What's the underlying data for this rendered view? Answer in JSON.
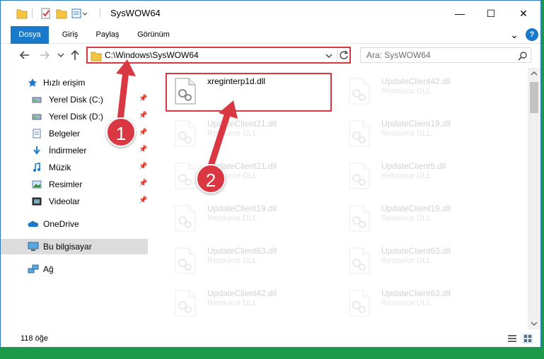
{
  "window": {
    "title": "SysWOW64",
    "minimize_glyph": "—",
    "maximize_glyph": "☐",
    "close_glyph": "✕"
  },
  "ribbon": {
    "tabs": [
      "Dosya",
      "Giriş",
      "Paylaş",
      "Görünüm"
    ],
    "collapse_glyph": "⌄",
    "help_glyph": "?"
  },
  "address": {
    "path": "C:\\Windows\\SysWOW64",
    "search_placeholder": "Ara: SysWOW64"
  },
  "sidebar": {
    "items": [
      {
        "label": "Hızlı erişim",
        "icon": "star-icon",
        "pinned": false
      },
      {
        "label": "Yerel Disk (C:)",
        "icon": "drive-icon",
        "pinned": true
      },
      {
        "label": "Yerel Disk (D:)",
        "icon": "drive-icon",
        "pinned": true
      },
      {
        "label": "Belgeler",
        "icon": "documents-icon",
        "pinned": true
      },
      {
        "label": "İndirmeler",
        "icon": "download-icon",
        "pinned": true
      },
      {
        "label": "Müzik",
        "icon": "music-icon",
        "pinned": true
      },
      {
        "label": "Resimler",
        "icon": "pictures-icon",
        "pinned": true
      },
      {
        "label": "Videolar",
        "icon": "videos-icon",
        "pinned": true
      },
      {
        "label": "OneDrive",
        "icon": "cloud-icon",
        "pinned": false
      },
      {
        "label": "Bu bilgisayar",
        "icon": "computer-icon",
        "pinned": false
      },
      {
        "label": "Ağ",
        "icon": "network-icon",
        "pinned": false
      }
    ]
  },
  "files": [
    {
      "name": "xreginterp1d.dll",
      "desc": "",
      "faded": false
    },
    {
      "name": "UpdateClient42.dll",
      "desc": "Resource DLL",
      "faded": true
    },
    {
      "name": "UpdateClient21.dll",
      "desc": "Resource DLL",
      "faded": true
    },
    {
      "name": "UpdateClient19.dll",
      "desc": "Resource DLL",
      "faded": true
    },
    {
      "name": "UpdateClient21.dll",
      "desc": "Resource DLL",
      "faded": true
    },
    {
      "name": "UpdateClient5.dll",
      "desc": "Resource DLL",
      "faded": true
    },
    {
      "name": "UpdateClient19.dll",
      "desc": "Resource DLL",
      "faded": true
    },
    {
      "name": "UpdateClient19.dll",
      "desc": "Resource DLL",
      "faded": true
    },
    {
      "name": "UpdateClient63.dll",
      "desc": "Resource DLL",
      "faded": true
    },
    {
      "name": "UpdateClient63.dll",
      "desc": "Resource DLL",
      "faded": true
    },
    {
      "name": "UpdateClient42.dll",
      "desc": "Resource DLL",
      "faded": true
    },
    {
      "name": "UpdateClient63.dll",
      "desc": "Resource DLL",
      "faded": true
    }
  ],
  "status": {
    "count": "118 öğe"
  },
  "annotations": {
    "step1": "1",
    "step2": "2",
    "color": "#d93842"
  },
  "colors": {
    "accent": "#1979ca",
    "highlight": "#d93842",
    "desktop": "#1a9a4a"
  }
}
